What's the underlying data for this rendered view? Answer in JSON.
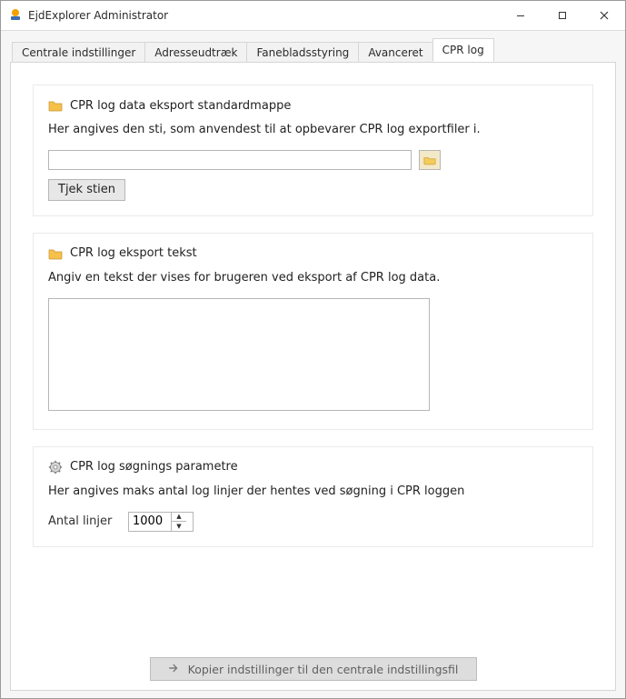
{
  "window": {
    "title": "EjdExplorer Administrator"
  },
  "tabs": {
    "items": [
      {
        "label": "Centrale indstillinger"
      },
      {
        "label": "Adresseudtræk"
      },
      {
        "label": "Fanebladsstyring"
      },
      {
        "label": "Avanceret"
      },
      {
        "label": "CPR log"
      }
    ],
    "active_index": 4
  },
  "group_export_folder": {
    "title": "CPR log data eksport standardmappe",
    "desc": "Her angives den sti, som anvendest til at opbevarer CPR log exportfiler i.",
    "path_value": "",
    "check_button": "Tjek stien"
  },
  "group_export_text": {
    "title": "CPR log eksport tekst",
    "desc": "Angiv en tekst der vises for brugeren ved eksport af CPR log data.",
    "text_value": ""
  },
  "group_search_params": {
    "title": "CPR log søgnings parametre",
    "desc": "Her angives maks antal log linjer der hentes ved søgning i CPR loggen",
    "count_label": "Antal linjer",
    "count_value": "1000"
  },
  "bottom": {
    "copy_label": "Kopier indstillinger til den centrale indstillingsfil"
  }
}
